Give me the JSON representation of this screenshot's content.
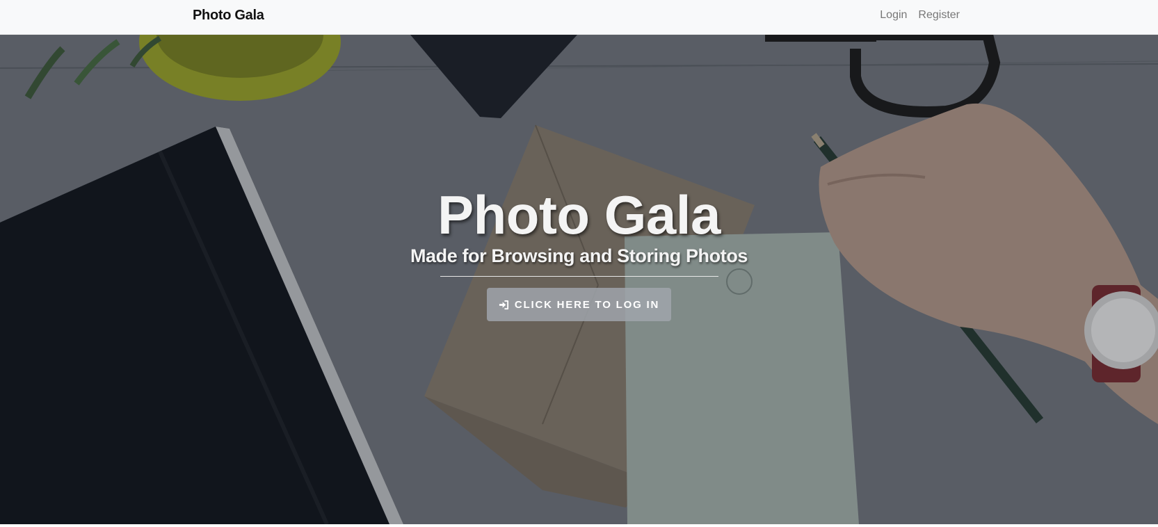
{
  "navbar": {
    "brand": "Photo Gala",
    "links": [
      {
        "label": "Login"
      },
      {
        "label": "Register"
      }
    ]
  },
  "hero": {
    "title": "Photo Gala",
    "subtitle": "Made for Browsing and Storing Photos",
    "cta": {
      "label": "Click here to log in",
      "icon": "sign-in-icon"
    }
  },
  "colors": {
    "navbar_bg": "#f8f9fa",
    "hero_text": "#f4f4f4",
    "button_bg": "#a0a5ac"
  }
}
